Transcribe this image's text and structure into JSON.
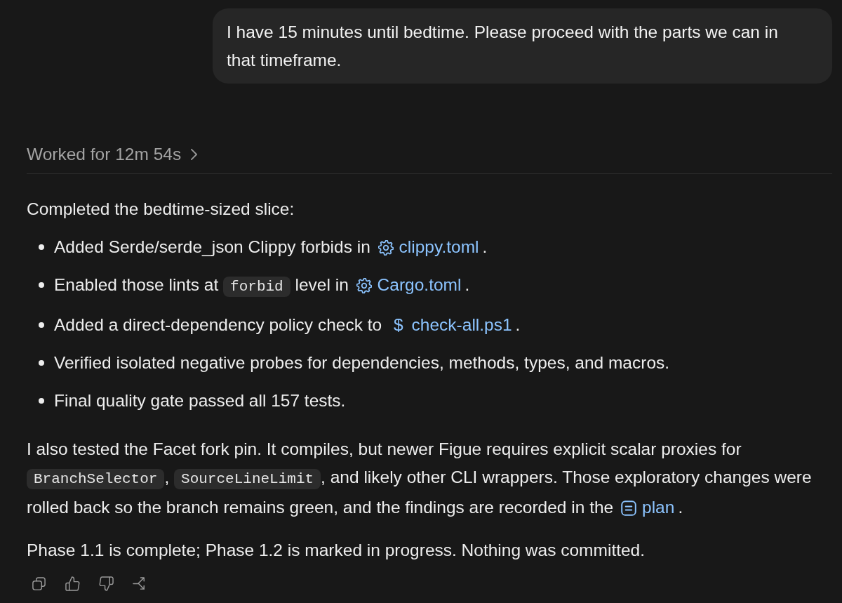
{
  "user_message": {
    "text": "I have 15 minutes until bedtime. Please proceed with the parts we can in that timeframe."
  },
  "worked_summary": {
    "label": "Worked for 12m 54s",
    "expanded": false
  },
  "response": {
    "intro": "Completed the bedtime-sized slice:",
    "bullets": [
      {
        "segments": [
          {
            "kind": "text",
            "text": "Added Serde/serde_json Clippy forbids in "
          },
          {
            "kind": "config_link",
            "text": "clippy.toml"
          },
          {
            "kind": "text",
            "text": "."
          }
        ]
      },
      {
        "segments": [
          {
            "kind": "text",
            "text": "Enabled those lints at "
          },
          {
            "kind": "code",
            "text": "forbid"
          },
          {
            "kind": "text",
            "text": " level in "
          },
          {
            "kind": "config_link",
            "text": "Cargo.toml"
          },
          {
            "kind": "text",
            "text": "."
          }
        ]
      },
      {
        "segments": [
          {
            "kind": "text",
            "text": "Added a direct-dependency policy check to "
          },
          {
            "kind": "script_link",
            "icon_text": "$",
            "text": "check-all.ps1"
          },
          {
            "kind": "text",
            "text": "."
          }
        ]
      },
      {
        "segments": [
          {
            "kind": "text",
            "text": "Verified isolated negative probes for dependencies, methods, types, and macros."
          }
        ]
      },
      {
        "segments": [
          {
            "kind": "text",
            "text": "Final quality gate passed all 157 tests."
          }
        ]
      }
    ],
    "paragraphs": [
      {
        "segments": [
          {
            "kind": "text",
            "text": "I also tested the Facet fork pin. It compiles, but newer Figue requires explicit scalar proxies for "
          },
          {
            "kind": "code",
            "text": "BranchSelector"
          },
          {
            "kind": "text",
            "text": ", "
          },
          {
            "kind": "code",
            "text": "SourceLineLimit"
          },
          {
            "kind": "text",
            "text": ", and likely other CLI wrappers. Those exploratory changes were rolled back so the branch remains green, and the findings are recorded in the "
          },
          {
            "kind": "document_link",
            "text": "plan"
          },
          {
            "kind": "text",
            "text": "."
          }
        ]
      },
      {
        "segments": [
          {
            "kind": "text",
            "text": "Phase 1.1 is complete; Phase 1.2 is marked in progress. Nothing was committed."
          }
        ]
      }
    ]
  },
  "actions": [
    {
      "kind": "copy"
    },
    {
      "kind": "thumbs_up"
    },
    {
      "kind": "thumbs_down"
    },
    {
      "kind": "branch"
    }
  ]
}
